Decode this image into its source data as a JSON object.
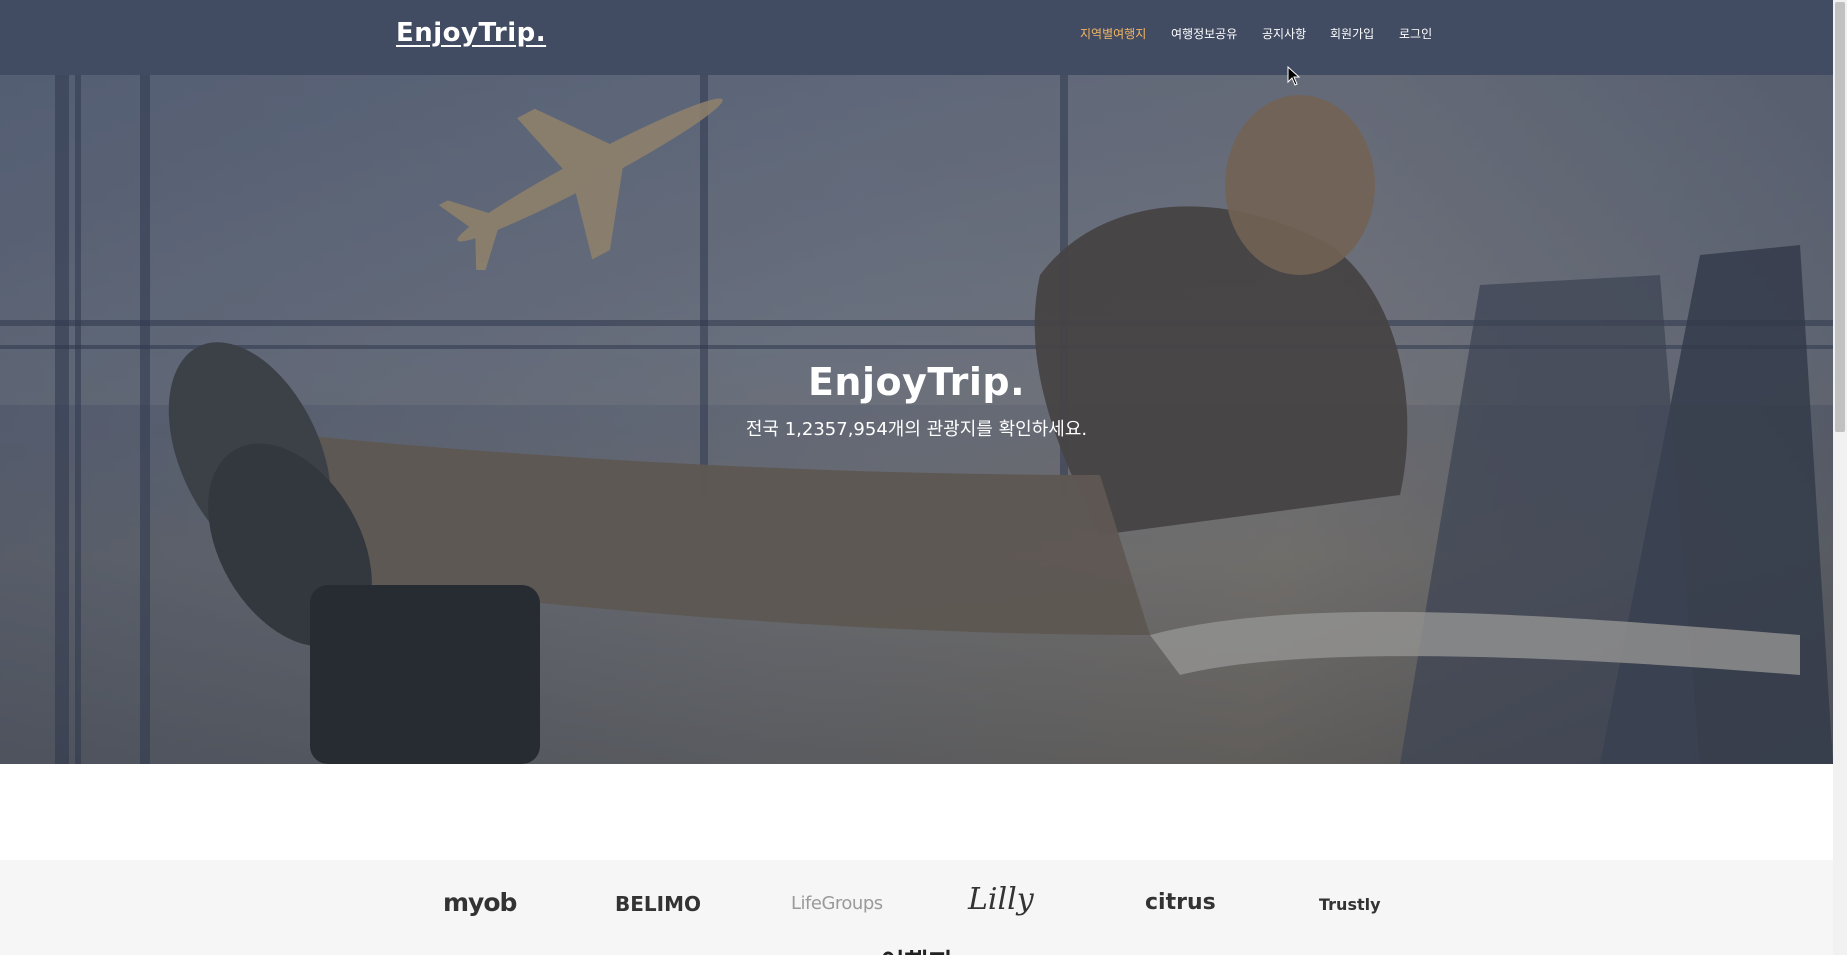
{
  "nav": {
    "brand": "EnjoyTrip.",
    "items": [
      {
        "label": "지역별여행지",
        "active": true
      },
      {
        "label": "여행정보공유",
        "active": false
      },
      {
        "label": "공지사항",
        "active": false
      },
      {
        "label": "회원가입",
        "active": false
      },
      {
        "label": "로그인",
        "active": false
      }
    ]
  },
  "hero": {
    "title": "EnjoyTrip.",
    "subtitle": "전국 1,2357,954개의 관광지를 확인하세요."
  },
  "partners": {
    "logos": [
      "myob",
      "BELIMO",
      "LifeGroups",
      "Lilly",
      "citrus",
      "Trustly"
    ],
    "section_heading": "여행지"
  },
  "colors": {
    "nav_bg": "#414b62",
    "active": "#f2b563"
  }
}
